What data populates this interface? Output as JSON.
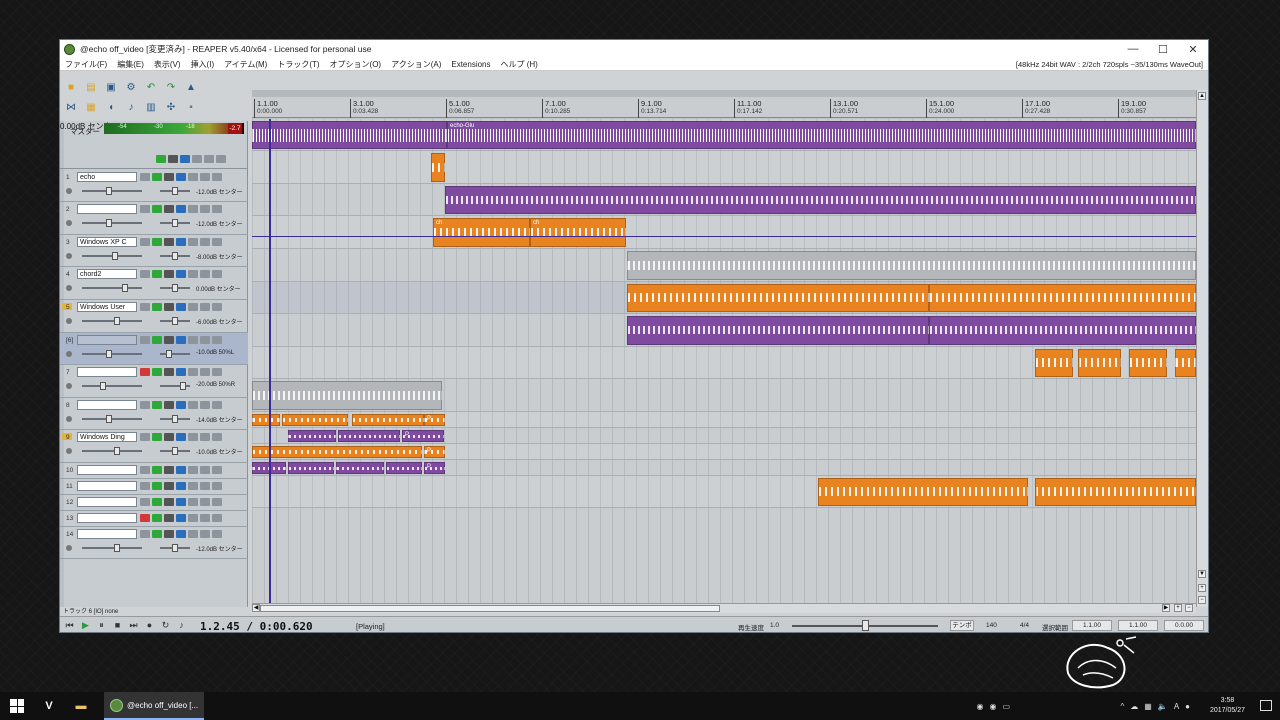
{
  "window": {
    "title": "@echo off_video [変更済み] - REAPER v5.40/x64 - Licensed for personal use",
    "minimize": "—",
    "maximize": "☐",
    "close": "✕"
  },
  "menu": {
    "items": [
      "ファイル(F)",
      "編集(E)",
      "表示(V)",
      "挿入(I)",
      "アイテム(M)",
      "トラック(T)",
      "オプション(O)",
      "アクション(A)",
      "Extensions",
      "ヘルプ (H)"
    ],
    "status": "[48kHz 24bit WAV : 2/2ch 720spls ~35/130ms WaveOut]"
  },
  "master": {
    "label": "マスター",
    "meter_peak": "-2.7",
    "meter_left": "-54",
    "meter_mid": "-30",
    "meter_right": "-18",
    "volume": "0.00dB センター"
  },
  "tracks": [
    {
      "num": "1",
      "name": "echo",
      "vol": "-12.0dB センター",
      "folder": false,
      "selected": false
    },
    {
      "num": "2",
      "name": "",
      "vol": "-12.0dB センター",
      "folder": false,
      "selected": false
    },
    {
      "num": "3",
      "name": "Windows XP C",
      "vol": "-8.00dB センター",
      "folder": false,
      "selected": false
    },
    {
      "num": "4",
      "name": "chord2",
      "vol": "0.00dB センター",
      "folder": false,
      "selected": false
    },
    {
      "num": "5",
      "name": "Windows User",
      "vol": "-6.00dB センター",
      "folder": true,
      "selected": false
    },
    {
      "num": "[6]",
      "name": "",
      "vol": "-10.0dB 50%L",
      "folder": false,
      "selected": true
    },
    {
      "num": "7",
      "name": "",
      "vol": "-20.0dB 50%R",
      "folder": false,
      "selected": false
    },
    {
      "num": "8",
      "name": "",
      "vol": "-14.0dB センター",
      "folder": false,
      "selected": false
    },
    {
      "num": "9",
      "name": "Windows Ding",
      "vol": "-10.0dB センター",
      "folder": true,
      "selected": false
    },
    {
      "num": "10",
      "name": "",
      "vol": "",
      "folder": false,
      "selected": false
    },
    {
      "num": "11",
      "name": "",
      "vol": "",
      "folder": false,
      "selected": false
    },
    {
      "num": "12",
      "name": "",
      "vol": "",
      "folder": false,
      "selected": false
    },
    {
      "num": "13",
      "name": "",
      "vol": "",
      "folder": false,
      "selected": false
    },
    {
      "num": "14",
      "name": "",
      "vol": "-12.0dB センター",
      "folder": false,
      "selected": false
    }
  ],
  "ruler": [
    {
      "bar": "1.1.00",
      "time": "0:00.000"
    },
    {
      "bar": "3.1.00",
      "time": "0:03.428"
    },
    {
      "bar": "5.1.00",
      "time": "0:06.857"
    },
    {
      "bar": "7.1.00",
      "time": "0:10.285"
    },
    {
      "bar": "9.1.00",
      "time": "0:13.714"
    },
    {
      "bar": "11.1.00",
      "time": "0:17.142"
    },
    {
      "bar": "13.1.00",
      "time": "0:20.571"
    },
    {
      "bar": "15.1.00",
      "time": "0:24.000"
    },
    {
      "bar": "17.1.00",
      "time": "0:27.428"
    },
    {
      "bar": "19.1.00",
      "time": "0:30.857"
    }
  ],
  "item_labels": {
    "echo_2": "echo-Glu",
    "chord_a": "ch",
    "chord_b": "ch",
    "p_a": "P",
    "p_b": "P",
    "p_c": "P",
    "p_d": "P"
  },
  "status_line": "トラック 6 [IO] none",
  "transport": {
    "time": "1.2.45 / 0:00.620",
    "state": "[Playing]",
    "rate_label": "再生速度",
    "rate_value": "1.0",
    "tempo_button": "テンポ",
    "bpm": "140",
    "timesig": "4/4",
    "sel_label": "選択範囲",
    "sel_start": "1.1.00",
    "sel_end": "1.1.00",
    "sel_len": "0.0.00"
  },
  "taskbar": {
    "active_title": "@echo off_video [...",
    "time": "3:58",
    "date": "2017/05/27",
    "ime": "A"
  },
  "colors": {
    "purple_item": "#7e4ba0",
    "orange_item": "#e8831f",
    "gray_item": "#b4b7ba",
    "cursor": "#3a2a9a"
  }
}
